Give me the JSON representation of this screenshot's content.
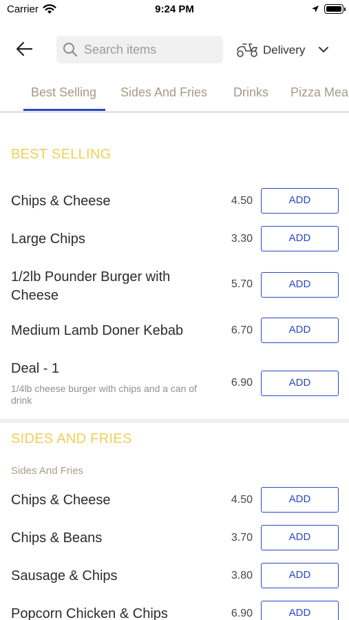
{
  "status_bar": {
    "carrier": "Carrier",
    "time": "9:24 PM"
  },
  "header": {
    "search": {
      "placeholder": "Search items",
      "value": ""
    },
    "delivery_label": "Delivery"
  },
  "tabs": [
    {
      "label": "Best Selling",
      "active": true
    },
    {
      "label": "Sides And Fries",
      "active": false
    },
    {
      "label": "Drinks",
      "active": false
    },
    {
      "label": "Pizza Meal",
      "active": false
    }
  ],
  "sections": [
    {
      "title": "BEST SELLING",
      "subtitle": "",
      "items": [
        {
          "name": "Chips & Cheese",
          "description": "",
          "price": "4.50",
          "button": "ADD"
        },
        {
          "name": "Large Chips",
          "description": "",
          "price": "3.30",
          "button": "ADD"
        },
        {
          "name": "1/2lb Pounder Burger with Cheese",
          "description": "",
          "price": "5.70",
          "button": "ADD"
        },
        {
          "name": "Medium Lamb Doner Kebab",
          "description": "",
          "price": "6.70",
          "button": "ADD"
        },
        {
          "name": "Deal - 1",
          "description": "1/4lb cheese burger with chips and a can of drink",
          "price": "6.90",
          "button": "ADD"
        }
      ]
    },
    {
      "title": "SIDES AND FRIES",
      "subtitle": "Sides And Fries",
      "items": [
        {
          "name": "Chips & Cheese",
          "description": "",
          "price": "4.50",
          "button": "ADD"
        },
        {
          "name": "Chips & Beans",
          "description": "",
          "price": "3.70",
          "button": "ADD"
        },
        {
          "name": "Sausage & Chips",
          "description": "",
          "price": "3.80",
          "button": "ADD"
        },
        {
          "name": "Popcorn Chicken & Chips",
          "description": "",
          "price": "6.90",
          "button": "ADD"
        }
      ]
    }
  ],
  "colors": {
    "accent": "#2a46c7",
    "section_title": "#f0cf57",
    "tab_text": "#a49b86"
  }
}
